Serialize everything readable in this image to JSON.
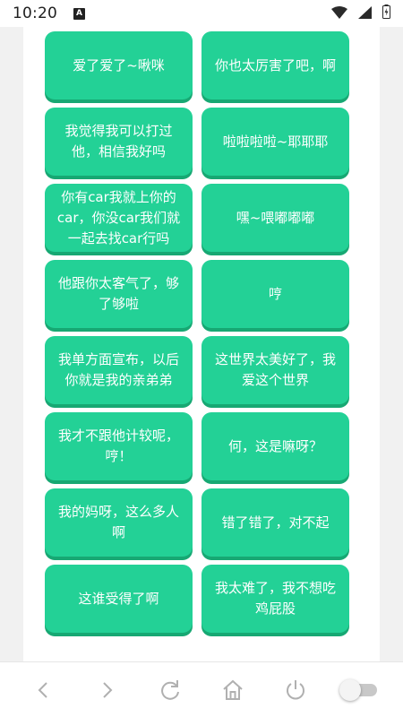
{
  "status_bar": {
    "time": "10:20",
    "notification_badge": "A",
    "icons": [
      "wifi-icon",
      "signal-icon",
      "battery-icon"
    ]
  },
  "sound_buttons": [
    {
      "label": "爱了爱了~啾咪"
    },
    {
      "label": "你也太厉害了吧，啊"
    },
    {
      "label": "我觉得我可以打过他，相信我好吗"
    },
    {
      "label": "啦啦啦啦~耶耶耶"
    },
    {
      "label": "你有car我就上你的car，你没car我们就一起去找car行吗"
    },
    {
      "label": "嘿~喂嘟嘟嘟"
    },
    {
      "label": "他跟你太客气了，够了够啦"
    },
    {
      "label": "哼"
    },
    {
      "label": "我单方面宣布，以后你就是我的亲弟弟"
    },
    {
      "label": "这世界太美好了，我爱这个世界"
    },
    {
      "label": "我才不跟他计较呢，哼！"
    },
    {
      "label": "何，这是嘛呀？"
    },
    {
      "label": "我的妈呀，这么多人啊"
    },
    {
      "label": "错了错了，对不起"
    },
    {
      "label": "这谁受得了啊"
    },
    {
      "label": "我太难了，我不想吃鸡屁股"
    }
  ],
  "nav_bar": {
    "icons": [
      "back-icon",
      "forward-icon",
      "refresh-icon",
      "home-icon",
      "power-icon",
      "toggle-switch"
    ]
  },
  "colors": {
    "card": "#23d196",
    "card_shadow": "#17a873",
    "panel": "#ffffff",
    "background": "#f1f1f1"
  }
}
